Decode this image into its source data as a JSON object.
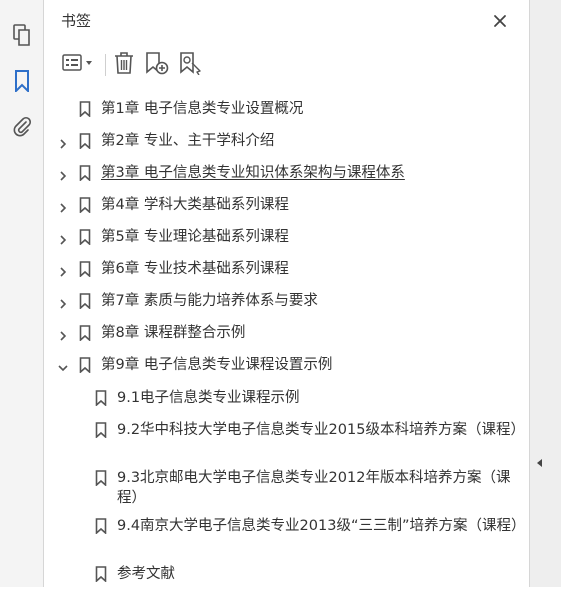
{
  "panel": {
    "title": "书签"
  },
  "rail": {
    "icons": [
      "pages-icon",
      "bookmark-icon",
      "attachment-icon"
    ]
  },
  "toolbar": {
    "icons": [
      "options-menu-icon",
      "delete-bookmark-icon",
      "new-bookmark-icon",
      "find-bookmark-icon"
    ]
  },
  "colors": {
    "accent": "#2d6fc9",
    "text": "#333333",
    "icon": "#555555"
  },
  "bookmarks": [
    {
      "label": "第1章  电子信息类专业设置概况",
      "expander": "none"
    },
    {
      "label": "第2章  专业、主干学科介绍",
      "expander": "collapsed"
    },
    {
      "label": "第3章  电子信息类专业知识体系架构与课程体系",
      "expander": "collapsed"
    },
    {
      "label": "第4章  学科大类基础系列课程",
      "expander": "collapsed"
    },
    {
      "label": "第5章  专业理论基础系列课程",
      "expander": "collapsed"
    },
    {
      "label": "第6章  专业技术基础系列课程",
      "expander": "collapsed"
    },
    {
      "label": "第7章  素质与能力培养体系与要求",
      "expander": "collapsed"
    },
    {
      "label": "第8章  课程群整合示例",
      "expander": "collapsed"
    },
    {
      "label": "第9章  电子信息类专业课程设置示例",
      "expander": "expanded"
    }
  ],
  "children": [
    {
      "label": "9.1电子信息类专业课程示例"
    },
    {
      "label": "9.2华中科技大学电子信息类专业2015级本科培养方案（课程）"
    },
    {
      "label": "9.3北京邮电大学电子信息类专业2012年版本科培养方案（课程）"
    },
    {
      "label": "9.4南京大学电子信息类专业2013级“三三制”培养方案（课程）"
    },
    {
      "label": "参考文献"
    }
  ]
}
